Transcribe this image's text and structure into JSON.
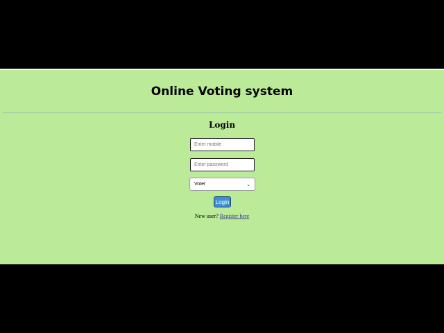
{
  "header": {
    "title": "Online Voting system"
  },
  "login_form": {
    "heading": "Login",
    "mobile_placeholder": "Enter mobile",
    "password_placeholder": "Enter password",
    "role_selected": "Voter",
    "submit_label": "Login",
    "register_prompt": "New user?",
    "register_link": "Register here"
  },
  "colors": {
    "page_background": "#bbea99",
    "button_background": "#3c8fd6",
    "letterbox": "#000000"
  },
  "icons": {
    "select_chevron": "chevron-down-icon"
  }
}
